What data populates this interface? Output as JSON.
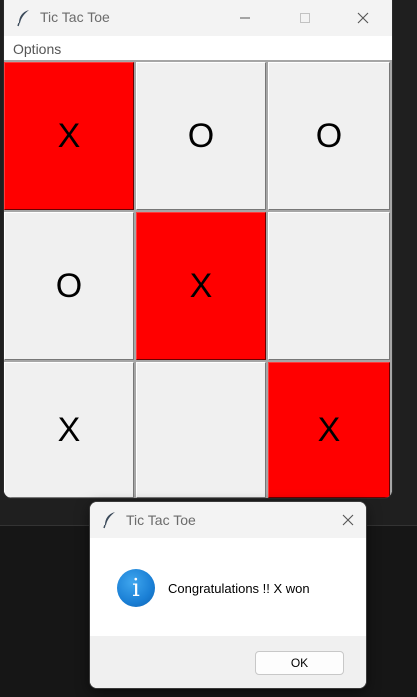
{
  "main_window": {
    "title": "Tic Tac Toe",
    "menu": {
      "options_label": "Options"
    },
    "board": {
      "cells": [
        {
          "mark": "X",
          "highlighted": true
        },
        {
          "mark": "O",
          "highlighted": false
        },
        {
          "mark": "O",
          "highlighted": false
        },
        {
          "mark": "O",
          "highlighted": false
        },
        {
          "mark": "X",
          "highlighted": true
        },
        {
          "mark": "",
          "highlighted": false
        },
        {
          "mark": "X",
          "highlighted": false
        },
        {
          "mark": "",
          "highlighted": false
        },
        {
          "mark": "X",
          "highlighted": true
        }
      ]
    }
  },
  "dialog": {
    "title": "Tic Tac Toe",
    "icon": "info-icon",
    "icon_glyph": "i",
    "message": "Congratulations !! X won",
    "ok_label": "OK"
  },
  "colors": {
    "win_highlight": "#ff0000",
    "cell_default": "#f0f0f0",
    "info_blue": "#1a7fd5"
  }
}
